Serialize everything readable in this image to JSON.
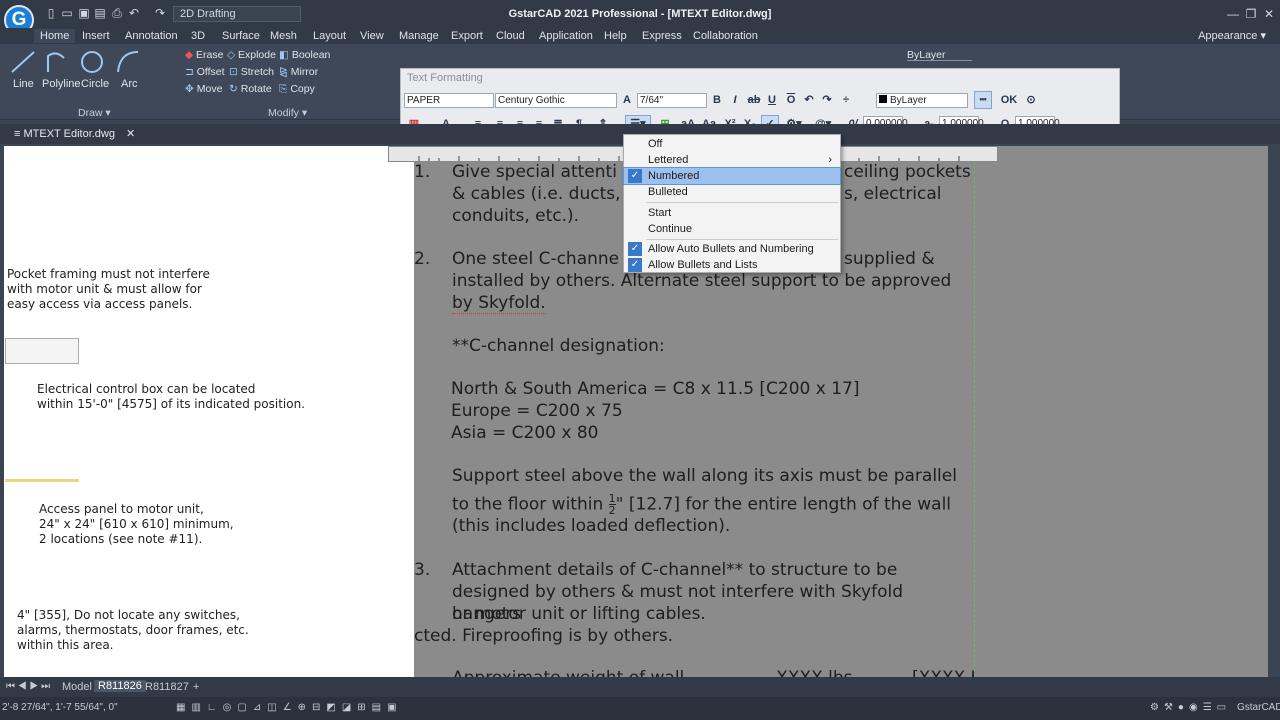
{
  "title_bar": {
    "workspace": "2D Drafting",
    "window_title": "GstarCAD 2021 Professional - [MTEXT Editor.dwg]",
    "logo_letter": "G"
  },
  "menu_tabs": [
    "Home",
    "Insert",
    "Annotation",
    "3D",
    "Surface",
    "Mesh",
    "Layout",
    "View",
    "Manage",
    "Export",
    "Cloud",
    "Application",
    "Help",
    "Express",
    "Collaboration"
  ],
  "appearance": "Appearance",
  "ribbon": {
    "draw_buttons": [
      "Line",
      "Polyline",
      "Circle",
      "Arc"
    ],
    "draw_panel": "Draw",
    "modify_rows": [
      [
        "Erase",
        "Explode",
        "Boolean"
      ],
      [
        "Offset",
        "Stretch",
        "Mirror"
      ],
      [
        "Move",
        "Rotate",
        "Copy"
      ]
    ],
    "modify_panel": "Modify",
    "bylayer": "ByLayer"
  },
  "text_formatting": {
    "title": "Text Formatting",
    "style": "PAPER",
    "font": "Century Gothic",
    "height": "7/64\"",
    "color": "ByLayer",
    "ok": "OK",
    "oblique": "0.000000",
    "tracking": "1.000000",
    "width": "1.000000"
  },
  "doc_tab": "MTEXT Editor.dwg",
  "drawing_notes": {
    "pocket": [
      "Pocket framing must not interfere",
      "with motor unit & must allow for",
      "easy access via access panels."
    ],
    "electrical": [
      "Electrical control box can be located",
      "within 15'-0\" [4575] of its indicated position."
    ],
    "access": [
      "Access panel to motor unit,",
      "24\" x 24\" [610 x 610] minimum,",
      "2 locations (see note #11)."
    ],
    "switches": [
      "4\" [355], Do not locate any switches,",
      "alarms, thermostats, door frames, etc.",
      "within this area."
    ]
  },
  "mtext": {
    "item1_num": "1.",
    "item1": [
      "Give special attenti",
      "ceiling pockets",
      "& cables (i.e. ducts,",
      "s, electrical",
      "conduits, etc.)."
    ],
    "item2_num": "2.",
    "item2": [
      "One steel C-channe",
      "supplied &",
      "installed by others. Alternate steel support to be approved",
      "by Skyfold."
    ],
    "designation": "**C-channel designation:",
    "regions": [
      "North & South America = C8 x 11.5 [C200 x 17]",
      "Europe = C200 x 75",
      "Asia = C200 x 80"
    ],
    "support": [
      "Support steel above the wall along its axis must be parallel",
      "to the floor within",
      "\" [12.7] for the entire length of the wall",
      "(this includes loaded deflection)."
    ],
    "frac_num": "1",
    "frac_den": "2",
    "item3_num": "3.",
    "item3": [
      "Attachment details of C-channel** to structure to be",
      "designed by others & must not interfere with Skyfold hangers",
      "or motor unit or lifting cables."
    ],
    "fire": "cted. Fireproofing is by others.",
    "item4_partial": "Approximate weight of wall.................XXXX lbs...........[XXXX Kg.]"
  },
  "dropdown": {
    "items": [
      {
        "label": "Off",
        "checked": false,
        "highlight": false
      },
      {
        "label": "Lettered",
        "checked": false,
        "highlight": false,
        "submenu": true
      },
      {
        "label": "Numbered",
        "checked": true,
        "highlight": true
      },
      {
        "label": "Bulleted",
        "checked": false,
        "highlight": false
      },
      {
        "label": "Start",
        "checked": false,
        "highlight": false
      },
      {
        "label": "Continue",
        "checked": false,
        "highlight": false
      },
      {
        "label": "Allow Auto Bullets and Numbering",
        "checked": true,
        "highlight": false
      },
      {
        "label": "Allow Bullets and Lists",
        "checked": true,
        "highlight": false
      }
    ]
  },
  "layout_tabs": [
    "Model",
    "R811826",
    "R811827"
  ],
  "status": {
    "coords": "2'-8 27/64\", 1'-7 55/64\", 0\"",
    "app_name": "GstarCAD"
  },
  "colors": {
    "highlight": "#9dc1ee",
    "check": "#3a78c9",
    "editor_bg": "#8b8b8b"
  }
}
